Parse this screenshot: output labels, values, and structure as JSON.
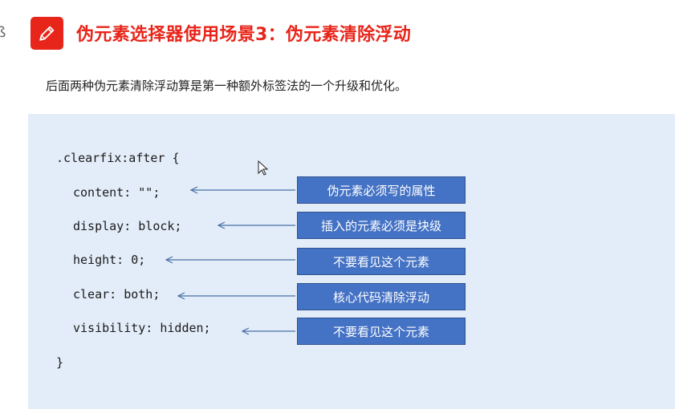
{
  "header": {
    "title": "伪元素选择器使用场景3：伪元素清除浮动",
    "icon": "pencil-icon",
    "accent_color": "#e8251a",
    "edge_glyph": "ß"
  },
  "description": "后面两种伪元素清除浮动算是第一种额外标签法的一个升级和优化。",
  "code": {
    "open": ".clearfix:after {",
    "lines": [
      "content: \"\";",
      "display: block;",
      "height: 0;",
      "clear: both;",
      "visibility: hidden;"
    ],
    "close": "}"
  },
  "annotations": [
    "伪元素必须写的属性",
    "插入的元素必须是块级",
    "不要看见这个元素",
    "核心代码清除浮动",
    "不要看见这个元素"
  ],
  "colors": {
    "panel_bg": "#e3edf9",
    "label_bg": "#4472c4",
    "arrow": "#4a6fa5"
  }
}
